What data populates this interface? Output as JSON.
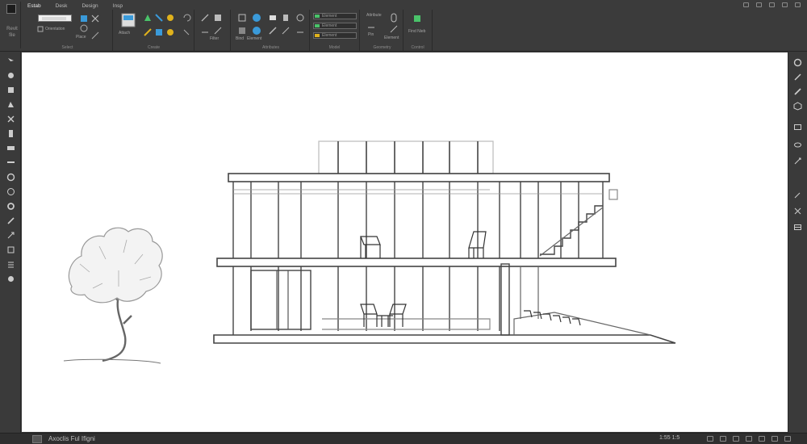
{
  "app": {
    "menu_label": "Revit\nfile"
  },
  "ribbon": {
    "tabs": [
      "Estab",
      "Desk",
      "Design",
      "Insp"
    ],
    "panels": [
      {
        "title": "Select",
        "labels": [
          "Orientation",
          "Place"
        ]
      },
      {
        "title": "Create",
        "labels": [
          "Attach"
        ]
      },
      {
        "title": "",
        "labels": [
          "Filter"
        ]
      },
      {
        "title": "Attributes",
        "labels": [
          "Bind",
          "Element"
        ]
      },
      {
        "title": "Model",
        "labels": [
          "Element",
          "Element",
          "Element"
        ]
      },
      {
        "title": "Geometry",
        "labels": [
          "Attribute",
          "Pin",
          "Element"
        ]
      },
      {
        "title": "Control",
        "labels": [
          "Find Nieb"
        ]
      }
    ]
  },
  "status": {
    "model_label": "Axoclis Ful Ifigni",
    "coords": "1:55  1:5"
  },
  "colors": {
    "accent_green": "#4ac36a",
    "accent_blue": "#3a9ad9",
    "accent_yellow": "#e0b21c"
  }
}
